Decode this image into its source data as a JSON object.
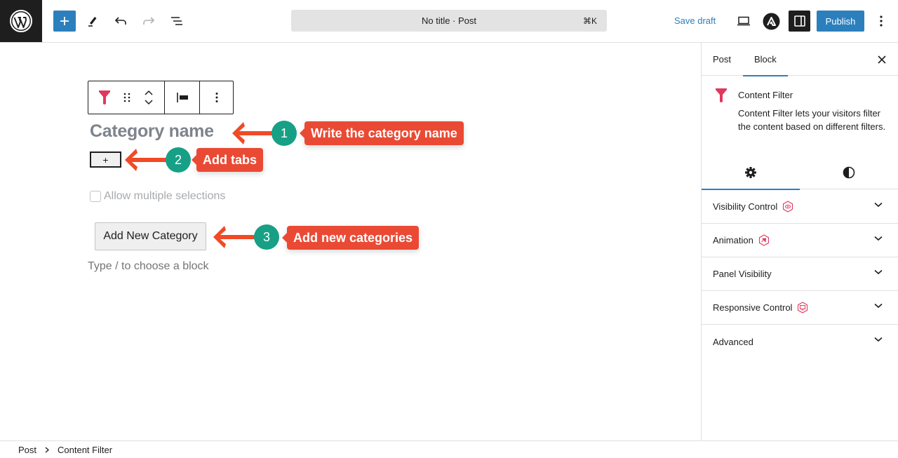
{
  "topbar": {
    "command_bar_title": "No title · Post",
    "command_bar_shortcut": "⌘K",
    "save_draft_label": "Save draft",
    "publish_label": "Publish",
    "icons": [
      "wordpress-logo",
      "plus-icon",
      "pencil-icon",
      "undo-icon",
      "redo-icon",
      "list-view-icon",
      "desktop-preview-icon",
      "astra-icon",
      "settings-sidebar-icon",
      "more-vertical-icon"
    ]
  },
  "editor": {
    "block_toolbar": {
      "icons": [
        "funnel-icon",
        "drag-handle-icon",
        "move-up-icon",
        "move-down-icon",
        "align-left-icon",
        "more-options-icon"
      ]
    },
    "category_name_placeholder": "Category name",
    "add_tab_label": "+",
    "allow_multiple_label": "Allow multiple selections",
    "allow_multiple_checked": false,
    "add_category_label": "Add New Category",
    "block_appender_placeholder": "Type / to choose a block"
  },
  "annotations": [
    {
      "number": "1",
      "label": "Write the category name"
    },
    {
      "number": "2",
      "label": "Add tabs"
    },
    {
      "number": "3",
      "label": "Add new categories"
    }
  ],
  "annotation_colors": {
    "arrow": "#f04a26",
    "badge": "#17a085",
    "label": "#ea4a34"
  },
  "sidebar": {
    "tabs": [
      {
        "label": "Post",
        "active": false
      },
      {
        "label": "Block",
        "active": true
      }
    ],
    "block": {
      "title": "Content Filter",
      "description": "Content Filter lets your visitors filter the content based on different filters."
    },
    "subtabs": [
      {
        "icon": "gear-icon",
        "active": true
      },
      {
        "icon": "contrast-icon",
        "active": false
      }
    ],
    "panels": [
      {
        "label": "Visibility Control",
        "badge": "eye-badge-icon"
      },
      {
        "label": "Animation",
        "badge": "animation-badge-icon"
      },
      {
        "label": "Panel Visibility",
        "badge": null
      },
      {
        "label": "Responsive Control",
        "badge": "responsive-badge-icon"
      },
      {
        "label": "Advanced",
        "badge": null
      }
    ]
  },
  "footer": {
    "breadcrumb": [
      "Post",
      "Content Filter"
    ]
  },
  "colors": {
    "accent": "#2c7fbd",
    "brand_pink": "#e0385e",
    "dark": "#1e1e1e"
  }
}
